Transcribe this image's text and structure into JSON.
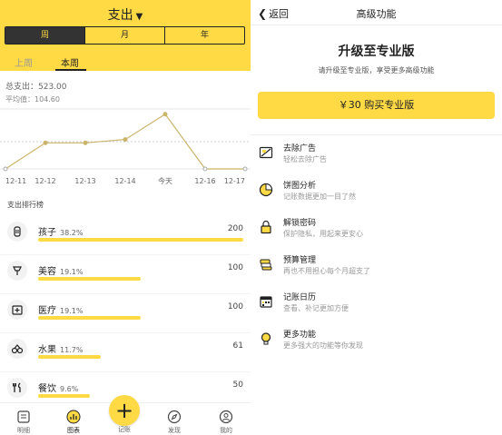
{
  "left": {
    "title": "支出",
    "caret": "▼",
    "segments": [
      "周",
      "月",
      "年"
    ],
    "active_segment": 0,
    "weeks": {
      "prev": "上周",
      "current": "本周"
    },
    "summary": {
      "total": "总支出：523.00",
      "average": "平均值：104.60"
    },
    "rank_title": "支出排行榜",
    "ranking": [
      {
        "name": "孩子",
        "pct": "38.2%",
        "amount": "200",
        "ratio": 1.0,
        "icon": "pacifier-icon"
      },
      {
        "name": "美容",
        "pct": "19.1%",
        "amount": "100",
        "ratio": 0.5,
        "icon": "beauty-icon"
      },
      {
        "name": "医疗",
        "pct": "19.1%",
        "amount": "100",
        "ratio": 0.5,
        "icon": "medical-icon"
      },
      {
        "name": "水果",
        "pct": "11.7%",
        "amount": "61",
        "ratio": 0.305,
        "icon": "fruit-icon"
      },
      {
        "name": "餐饮",
        "pct": "9.6%",
        "amount": "50",
        "ratio": 0.25,
        "icon": "dining-icon"
      }
    ],
    "tabs": {
      "detail": "明细",
      "chart": "图表",
      "add": "记账",
      "discover": "发现",
      "mine": "我的"
    }
  },
  "chart_data": {
    "type": "line",
    "categories": [
      "12-11",
      "12-12",
      "12-13",
      "12-14",
      "今天",
      "12-16",
      "12-17"
    ],
    "values": [
      0,
      100,
      100,
      113,
      210,
      0,
      0
    ],
    "average": 104.6,
    "ylim": [
      0,
      230
    ],
    "grid": true,
    "color": "#C9B46A"
  },
  "right": {
    "back_label": "返回",
    "title": "高级功能",
    "pro_title": "升级至专业版",
    "pro_subtitle": "请升级至专业版，享受更多高级功能",
    "buy_label": "￥30 购买专业版",
    "features": [
      {
        "name": "去除广告",
        "desc": "轻松去除广告",
        "icon": "no-ads-icon"
      },
      {
        "name": "饼图分析",
        "desc": "记账数据更加一目了然",
        "icon": "pie-chart-icon"
      },
      {
        "name": "解锁密码",
        "desc": "保护隐私，用起来更安心",
        "icon": "lock-icon"
      },
      {
        "name": "预算管理",
        "desc": "再也不用担心每个月超支了",
        "icon": "budget-icon"
      },
      {
        "name": "记账日历",
        "desc": "查看、补记更加方便",
        "icon": "calendar-icon"
      },
      {
        "name": "更多功能",
        "desc": "更多强大的功能等你发现",
        "icon": "bulb-icon"
      }
    ]
  },
  "colors": {
    "accent": "#FFDA44",
    "dark": "#333333"
  }
}
